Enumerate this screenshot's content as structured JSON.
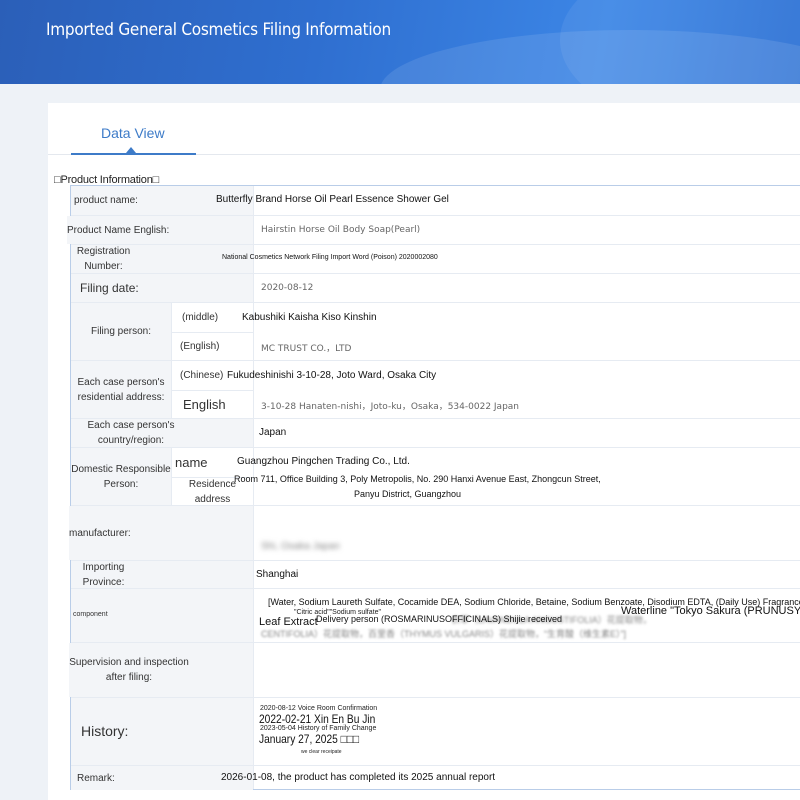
{
  "page_title": "Imported General Cosmetics Filing Information",
  "tab": "Data View",
  "section_title": "□Product Information□",
  "rows": {
    "product_name": {
      "label": "product name:",
      "value": "Butterfly Brand Horse Oil Pearl Essence Shower Gel"
    },
    "product_name_en": {
      "label": "Product Name English:",
      "value": "Hairstin Horse Oil Body Soap(Pearl)"
    },
    "registration": {
      "label": "Registration Number:",
      "value": "National Cosmetics Network Filing Import Word (Poison) 2020002080"
    },
    "filing_date": {
      "label": "Filing date:",
      "value": "2020-08-12"
    },
    "filing_person": {
      "label": "Filing person:",
      "middle_label": "(middle)",
      "middle_value": "Kabushiki Kaisha Kiso Kinshin",
      "english_label": "(English)",
      "english_value": "MC TRUST CO.，LTD"
    },
    "residential": {
      "label": "Each case person's residential address:",
      "chinese_label": "(Chinese)",
      "chinese_value": "Fukudeshinishi 3-10-28, Joto Ward, Osaka City",
      "english_label": "English",
      "english_value": "3-10-28 Hanaten-nishi，Joto-ku，Osaka，534-0022 Japan"
    },
    "country": {
      "label": "Each case person's country/region:",
      "value": "Japan"
    },
    "domestic": {
      "label": "Domestic Responsible Person:",
      "name_label": "name",
      "name_value": "Guangzhou Pingchen Trading Co., Ltd.",
      "address_label": "Residence address",
      "address_line1": "Room 711, Office Building 3, Poly Metropolis, No. 290 Hanxi Avenue East, Zhongcun Street,",
      "address_line2": "Panyu District, Guangzhou"
    },
    "manufacturer": {
      "label": "manufacturer:",
      "value": "Shi, Osaka Japan"
    },
    "importing": {
      "label": "Importing Province:",
      "value": "Shanghai"
    },
    "component": {
      "label": "component",
      "line1": "[Water, Sodium Laureth Sulfate, Cocamide DEA, Sodium Chloride, Betaine, Sodium Benzoate, Disodium EDTA, (Daily Use) Fragrance]",
      "note": "\"Citric acid\"\"Sodium sulfate\"",
      "leaf": "Leaf Extract",
      "delivery": "Delivery person (ROSMARINUSOFFICINALS) Shijie received",
      "waterline": "Waterline \"Tokyo Sakura (PRUNUSYEDOE",
      "blur1": "衣草（LAVANDULA ANGUSTIFOLIA）花提取物，",
      "blur2": "CENTIFOLIA）花提取物，百里香（THYMUS VULGARIS）花提取物，“生育酸（维生素E）”]"
    },
    "supervision": {
      "label": "Supervision and inspection after filing:"
    },
    "history": {
      "label": "History:",
      "line1": "2020-08-12 Voice Room Confirmation",
      "line2": "2022-02-21 Xin En Bu Jin",
      "line3": "2023-05-04 History of Family Change",
      "line4": "January 27, 2025 □□□",
      "line5": "we clear receipate"
    },
    "remark": {
      "label": "Remark:",
      "value": "2026-01-08, the product has completed its 2025 annual report"
    }
  }
}
